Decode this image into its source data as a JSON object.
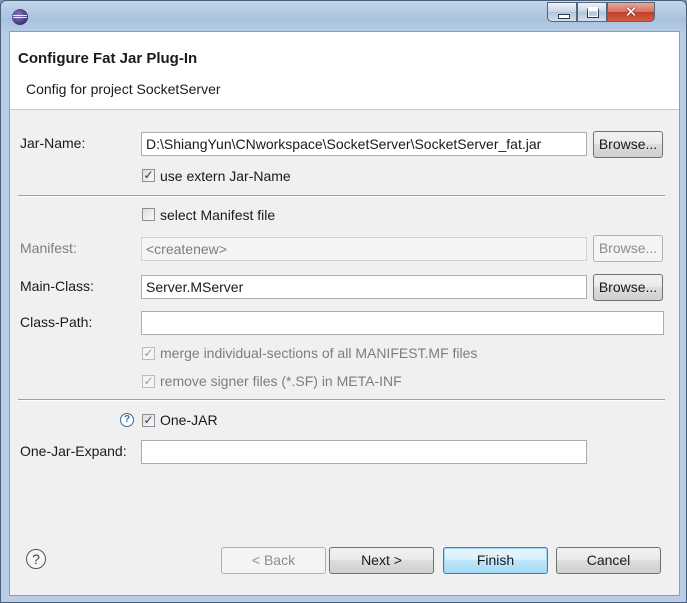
{
  "header": {
    "title": "Configure Fat Jar Plug-In",
    "description": "Config for project SocketServer"
  },
  "jar_name": {
    "label": "Jar-Name:",
    "value": "D:\\ShiangYun\\CNworkspace\\SocketServer\\SocketServer_fat.jar",
    "browse": "Browse...",
    "use_extern": "use extern Jar-Name",
    "use_extern_checked": true
  },
  "manifest": {
    "select_label": "select Manifest file",
    "select_checked": false,
    "label": "Manifest:",
    "value": "<createnew>",
    "browse": "Browse..."
  },
  "main_class": {
    "label": "Main-Class:",
    "value": "Server.MServer",
    "browse": "Browse..."
  },
  "class_path": {
    "label": "Class-Path:",
    "value": ""
  },
  "options": {
    "merge": "merge individual-sections of all MANIFEST.MF files",
    "merge_checked": true,
    "remove_signer": "remove signer files (*.SF) in META-INF",
    "remove_signer_checked": true
  },
  "one_jar": {
    "label": "One-JAR",
    "checked": true,
    "expand_label": "One-Jar-Expand:",
    "expand_value": ""
  },
  "footer": {
    "back": "< Back",
    "next": "Next >",
    "finish": "Finish",
    "cancel": "Cancel"
  },
  "icons": {
    "app": "eclipse-icon",
    "help": "help-icon",
    "minimize": "minimize-icon",
    "maximize": "maximize-icon",
    "close": "close-icon"
  },
  "glyphs": {
    "check": "✓",
    "question": "?",
    "close": "✕"
  }
}
